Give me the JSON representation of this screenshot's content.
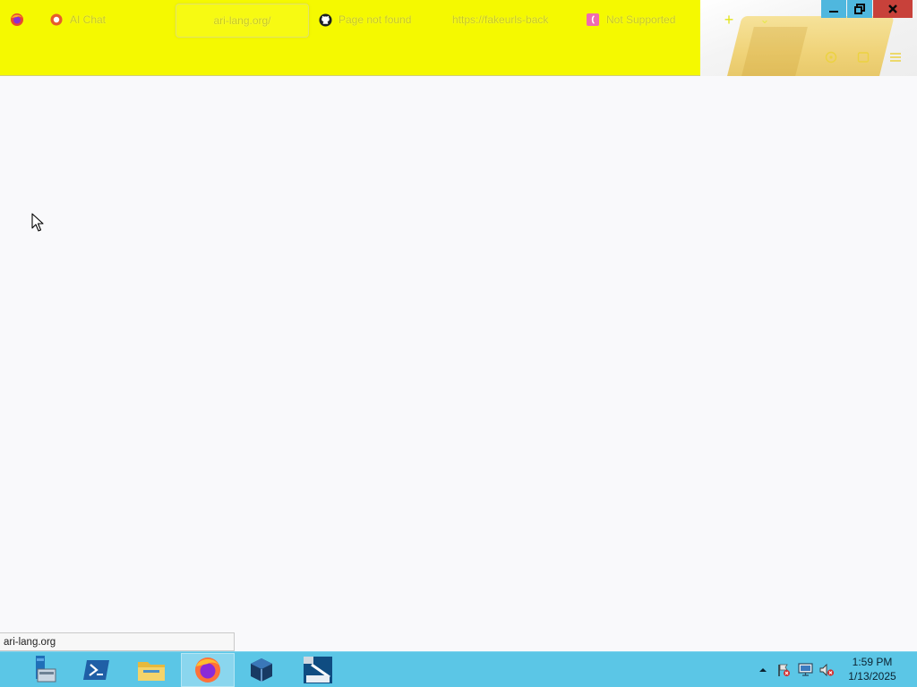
{
  "browser": {
    "tabs": [
      {
        "title": "AI Chat",
        "icon": "duckduckgo-ai-icon",
        "active": false
      },
      {
        "title": "ari-lang.org/",
        "icon": "",
        "active": true
      },
      {
        "title": "Page not found",
        "icon": "github-icon",
        "active": false
      },
      {
        "title": "https://fakeurls-back",
        "icon": "",
        "active": false
      },
      {
        "title": "Not Supported",
        "icon": "pink-page-icon",
        "active": false
      }
    ],
    "new_tab_symbol": "+",
    "list_tabs_symbol": "⌄",
    "toolbar_icons": [
      "extensions-icon",
      "account-icon",
      "menu-icon"
    ],
    "status_url": "ari-lang.org",
    "theme_color": "#f5f900"
  },
  "window_controls": [
    "minimize-icon",
    "restore-icon",
    "close-icon"
  ],
  "taskbar": {
    "apps": [
      {
        "name": "server-manager-icon",
        "active": false
      },
      {
        "name": "powershell-icon",
        "active": false
      },
      {
        "name": "file-explorer-icon",
        "active": false
      },
      {
        "name": "firefox-icon",
        "active": true
      },
      {
        "name": "virtualbox-icon",
        "active": false
      },
      {
        "name": "windows-server-2012-icon",
        "active": false
      }
    ],
    "tray_icons": [
      "show-hidden-icons-arrow",
      "action-center-flag-icon",
      "network-icon",
      "volume-muted-icon"
    ],
    "time": "1:59 PM",
    "date": "1/13/2025",
    "color": "#5bc6e6"
  }
}
